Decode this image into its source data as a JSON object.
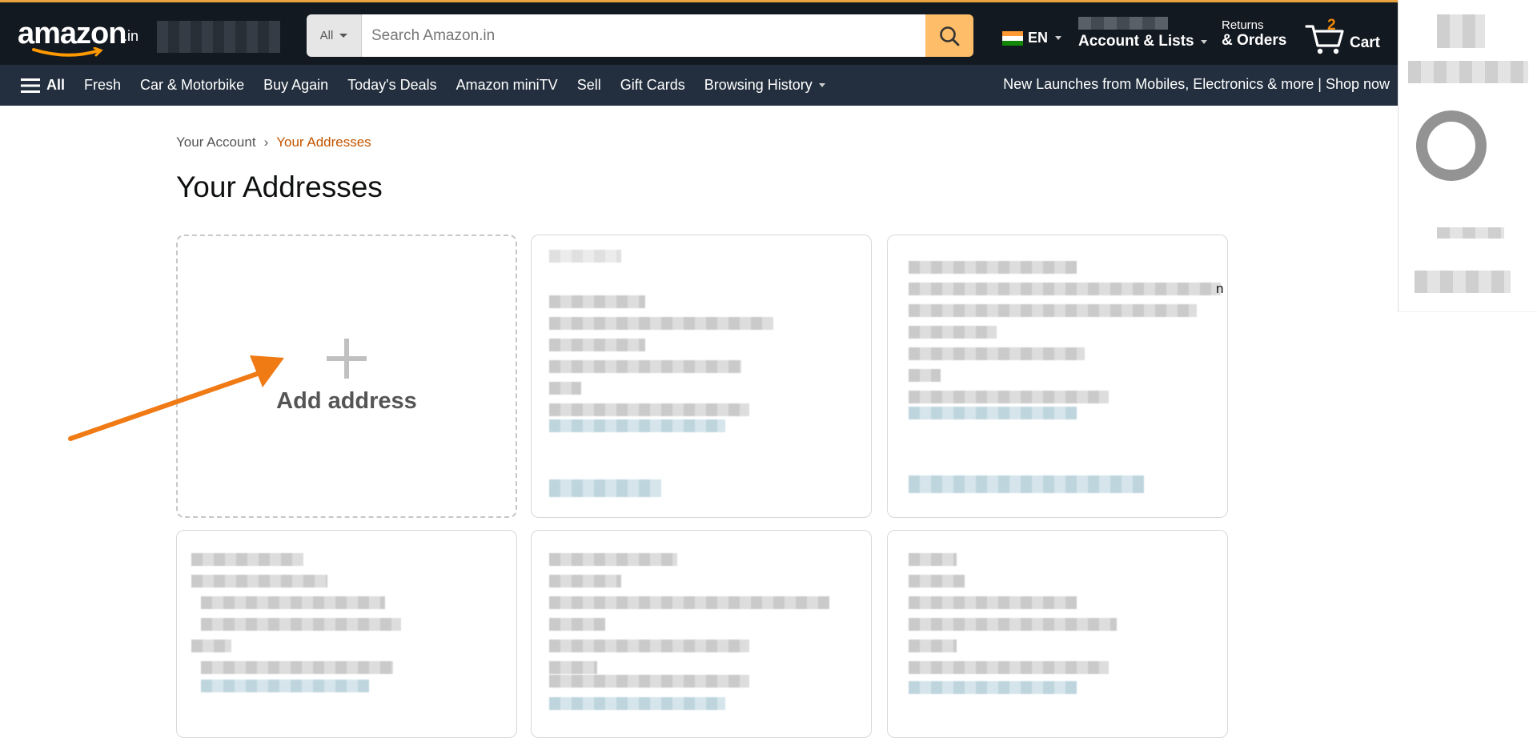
{
  "header": {
    "logo_text": "amazon",
    "logo_suffix": ".in",
    "search_category": "All",
    "search_placeholder": "Search Amazon.in",
    "language": "EN",
    "account_label": "Account & Lists",
    "returns_small": "Returns",
    "returns_big": "& Orders",
    "cart_count": "2",
    "cart_label": "Cart"
  },
  "nav": {
    "all_label": "All",
    "items": [
      "Fresh",
      "Car & Motorbike",
      "Buy Again",
      "Today's Deals",
      "Amazon miniTV",
      "Sell",
      "Gift Cards",
      "Browsing History"
    ],
    "promo": "New Launches from Mobiles, Electronics & more | Shop now"
  },
  "breadcrumb": {
    "parent": "Your Account",
    "separator": "›",
    "current": "Your Addresses"
  },
  "page": {
    "title": "Your Addresses",
    "add_address_label": "Add address",
    "stray_text": "n"
  },
  "colors": {
    "topbar": "#131921",
    "navbar": "#232f3e",
    "search_button": "#febd69",
    "breadcrumb_current": "#c45500",
    "annotation_arrow": "#f07a14"
  }
}
